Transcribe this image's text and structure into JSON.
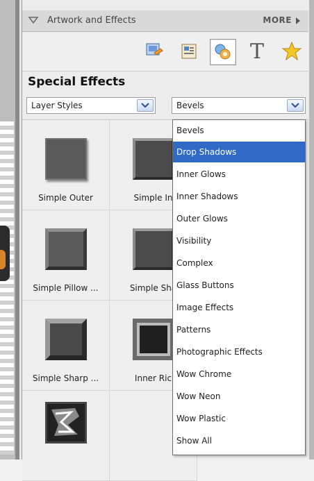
{
  "header": {
    "title": "Artwork and Effects",
    "more_label": "MORE"
  },
  "section_title": "Special Effects",
  "selects": {
    "category": {
      "value": "Layer Styles"
    },
    "style": {
      "value": "Bevels"
    }
  },
  "toolbar": {
    "icons": [
      "artwork-icon",
      "backgrounds-icon",
      "effects-icon",
      "text-icon",
      "favorites-icon"
    ],
    "text_tool_glyph": "T"
  },
  "grid": {
    "items": [
      {
        "label": "Simple Outer"
      },
      {
        "label": "Simple In"
      },
      {
        "label": "Simple Pillow ..."
      },
      {
        "label": "Simple Sha"
      },
      {
        "label": "Simple Sharp ..."
      },
      {
        "label": "Inner Ric"
      },
      {
        "label": ""
      }
    ]
  },
  "dropdown": {
    "items": [
      "Bevels",
      "Drop Shadows",
      "Inner Glows",
      "Inner Shadows",
      "Outer Glows",
      "Visibility",
      "Complex",
      "Glass Buttons",
      "Image Effects",
      "Patterns",
      "Photographic Effects",
      "Wow Chrome",
      "Wow Neon",
      "Wow Plastic",
      "Show All"
    ],
    "selected_index": 1
  },
  "colors": {
    "selection": "#3169c6",
    "star": "#f3c623"
  }
}
